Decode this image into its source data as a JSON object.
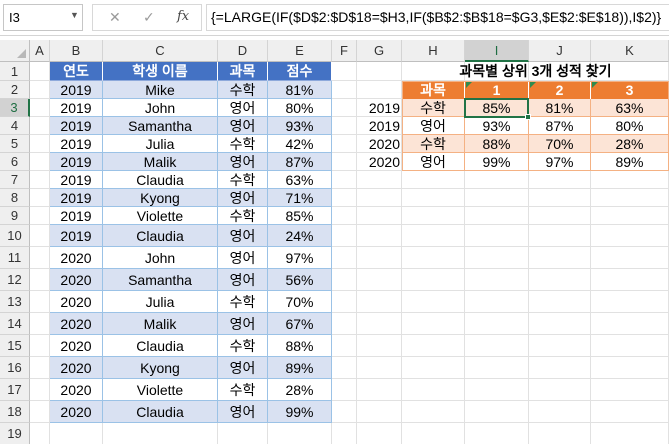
{
  "formula_bar": {
    "name_box": "I3",
    "cancel_icon": "✕",
    "enter_icon": "✓",
    "fx_label": "fx",
    "formula": "{=LARGE(IF($D$2:$D$18=$H3,IF($B$2:$B$18=$G3,$E$2:$E$18)),I$2)}"
  },
  "columns": [
    "A",
    "B",
    "C",
    "D",
    "E",
    "F",
    "G",
    "H",
    "I",
    "J",
    "K"
  ],
  "rows": [
    "1",
    "2",
    "3",
    "4",
    "5",
    "6",
    "7",
    "8",
    "9",
    "10",
    "11",
    "12",
    "13",
    "14",
    "15",
    "16",
    "17",
    "18",
    "19"
  ],
  "left_table": {
    "headers": [
      "연도",
      "학생 이름",
      "과목",
      "점수"
    ],
    "rows": [
      [
        "2019",
        "Mike",
        "수학",
        "81%"
      ],
      [
        "2019",
        "John",
        "영어",
        "80%"
      ],
      [
        "2019",
        "Samantha",
        "영어",
        "93%"
      ],
      [
        "2019",
        "Julia",
        "수학",
        "42%"
      ],
      [
        "2019",
        "Malik",
        "영어",
        "87%"
      ],
      [
        "2019",
        "Claudia",
        "수학",
        "63%"
      ],
      [
        "2019",
        "Kyong",
        "영어",
        "71%"
      ],
      [
        "2019",
        "Violette",
        "수학",
        "85%"
      ],
      [
        "2019",
        "Claudia",
        "영어",
        "24%"
      ],
      [
        "2020",
        "John",
        "영어",
        "97%"
      ],
      [
        "2020",
        "Samantha",
        "영어",
        "56%"
      ],
      [
        "2020",
        "Julia",
        "수학",
        "70%"
      ],
      [
        "2020",
        "Malik",
        "영어",
        "67%"
      ],
      [
        "2020",
        "Claudia",
        "수학",
        "88%"
      ],
      [
        "2020",
        "Kyong",
        "영어",
        "89%"
      ],
      [
        "2020",
        "Violette",
        "수학",
        "28%"
      ],
      [
        "2020",
        "Claudia",
        "영어",
        "99%"
      ]
    ]
  },
  "right_table": {
    "title": "과목별 상위 3개 성적 찾기",
    "headers": [
      "과목",
      "1",
      "2",
      "3"
    ],
    "years": [
      "2019",
      "2019",
      "2020",
      "2020"
    ],
    "rows": [
      [
        "수학",
        "85%",
        "81%",
        "63%"
      ],
      [
        "영어",
        "93%",
        "87%",
        "80%"
      ],
      [
        "수학",
        "88%",
        "70%",
        "28%"
      ],
      [
        "영어",
        "99%",
        "97%",
        "89%"
      ]
    ]
  },
  "colors": {
    "header_blue": "#4472c4",
    "band_blue": "#d9e1f2",
    "header_orange": "#ed7d31",
    "band_orange": "#fce4d6",
    "selection_green": "#217346"
  }
}
